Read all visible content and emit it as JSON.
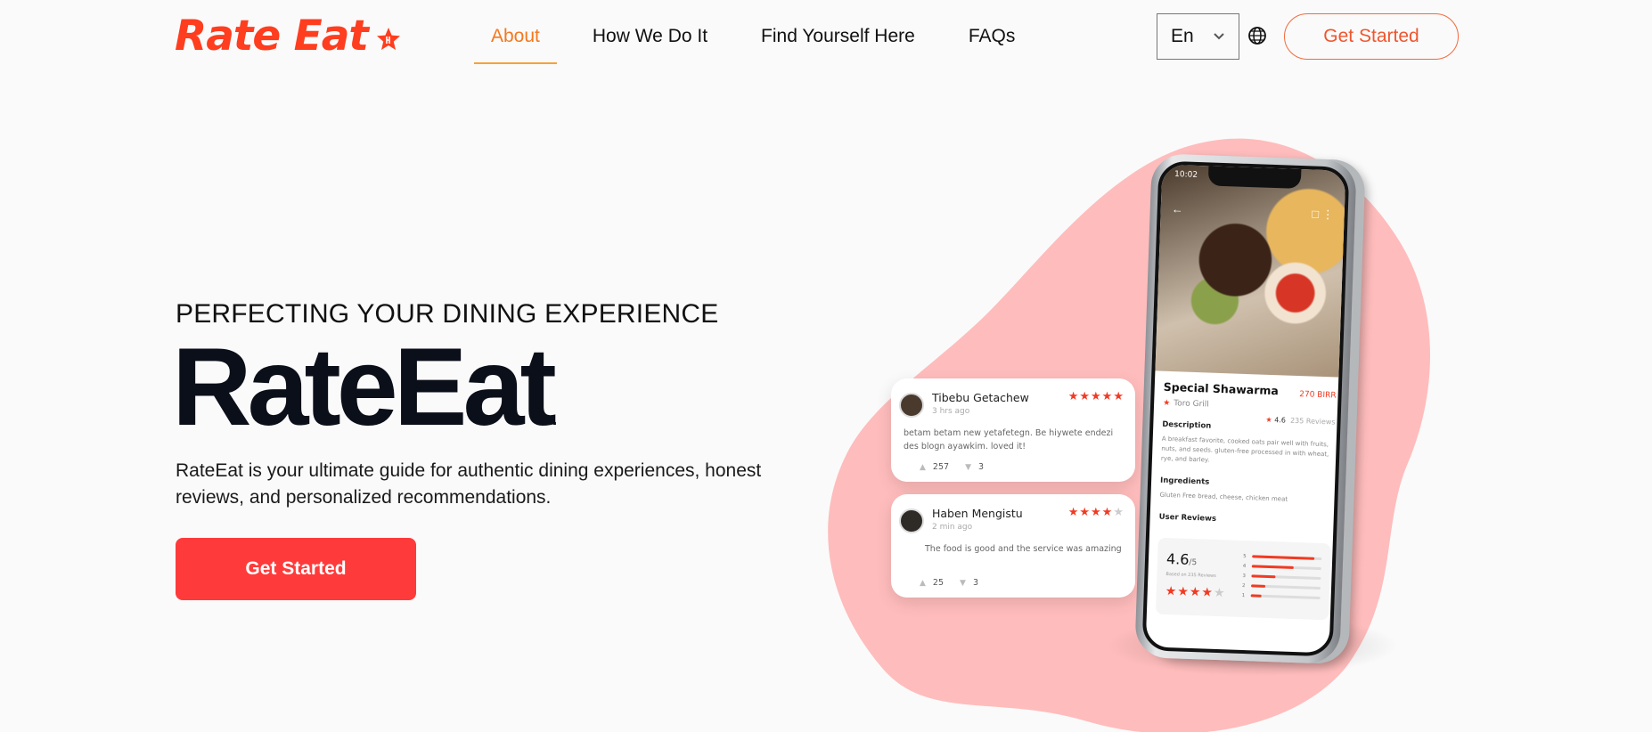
{
  "brand": {
    "logo_text": "Rate Eat",
    "accent": "#ff3d1f",
    "primary": "#ff3a3a",
    "active_nav": "#f5781f"
  },
  "nav": {
    "items": [
      {
        "label": "About",
        "active": true
      },
      {
        "label": "How We Do It",
        "active": false
      },
      {
        "label": "Find Yourself Here",
        "active": false
      },
      {
        "label": "FAQs",
        "active": false
      }
    ],
    "language": "En",
    "cta": "Get Started"
  },
  "hero": {
    "eyebrow": "PERFECTING YOUR DINING EXPERIENCE",
    "title": "RateEat",
    "title_dot": ".",
    "description": "RateEat is your ultimate guide for authentic dining experiences, honest reviews, and personalized recommendations.",
    "cta": "Get Started"
  },
  "reviews": [
    {
      "name": "Tibebu Getachew",
      "time": "3 hrs ago",
      "stars": 5,
      "text": "betam betam new yetafetegn. Be hiywete endezi des blogn ayawkim. loved it!",
      "upvotes": "257",
      "downvotes": "3"
    },
    {
      "name": "Haben Mengistu",
      "time": "2 min ago",
      "stars": 4,
      "text": "The food is good and the service was amazing",
      "upvotes": "25",
      "downvotes": "3"
    }
  ],
  "phone": {
    "clock": "10:02",
    "dish": "Special Shawarma",
    "price": "270 BIRR",
    "place": "Toro Grill",
    "rating": "4.6",
    "reviews_count": "235 Reviews",
    "description_heading": "Description",
    "description": "A breakfast favorite, cooked oats pair well with fruits, nuts, and seeds. gluten-free processed in with wheat, rye, and barley.",
    "ingredients_heading": "Ingredients",
    "ingredients": "Gluten Free bread, cheese, chicken meat",
    "user_reviews_heading": "User Reviews",
    "score": "4.6",
    "score_suffix": "/5",
    "score_note": "Based on 235 Reviews",
    "score_stars": 4,
    "distribution": [
      {
        "label": "5",
        "value": 0.9
      },
      {
        "label": "4",
        "value": 0.6
      },
      {
        "label": "3",
        "value": 0.35
      },
      {
        "label": "2",
        "value": 0.2
      },
      {
        "label": "1",
        "value": 0.15
      }
    ]
  }
}
